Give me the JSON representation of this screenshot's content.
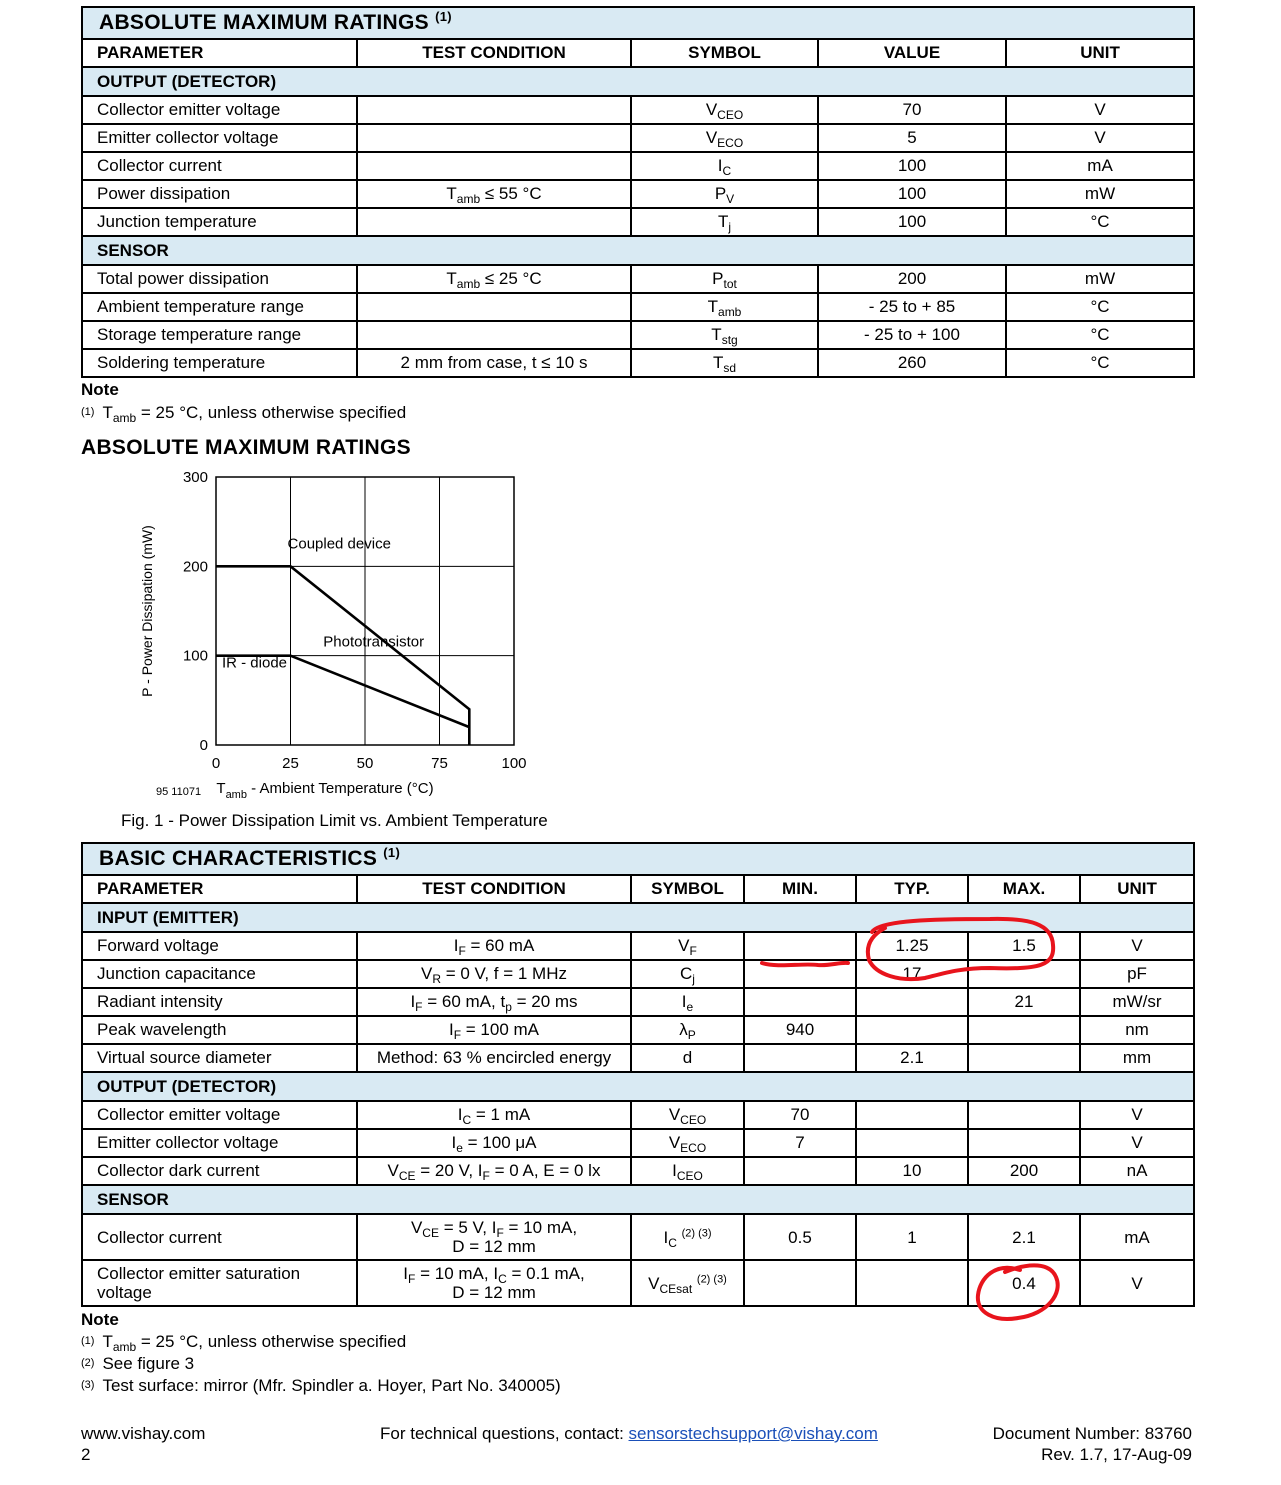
{
  "abs_table": {
    "title": "ABSOLUTE MAXIMUM RATINGS",
    "title_sup": "(1)",
    "headers": [
      "PARAMETER",
      "TEST CONDITION",
      "SYMBOL",
      "VALUE",
      "UNIT"
    ],
    "sections": [
      {
        "name": "OUTPUT (DETECTOR)",
        "rows": [
          {
            "param": "Collector emitter voltage",
            "cond": "",
            "cond_sub": "",
            "cond_rest": "",
            "sym": "V",
            "sym_sub": "CEO",
            "value": "70",
            "unit": "V"
          },
          {
            "param": "Emitter collector voltage",
            "cond": "",
            "cond_sub": "",
            "cond_rest": "",
            "sym": "V",
            "sym_sub": "ECO",
            "value": "5",
            "unit": "V"
          },
          {
            "param": "Collector current",
            "cond": "",
            "cond_sub": "",
            "cond_rest": "",
            "sym": "I",
            "sym_sub": "C",
            "value": "100",
            "unit": "mA"
          },
          {
            "param": "Power dissipation",
            "cond": "T",
            "cond_sub": "amb",
            "cond_rest": " ≤ 55 °C",
            "sym": "P",
            "sym_sub": "V",
            "value": "100",
            "unit": "mW"
          },
          {
            "param": "Junction temperature",
            "cond": "",
            "cond_sub": "",
            "cond_rest": "",
            "sym": "T",
            "sym_sub": "j",
            "value": "100",
            "unit": "°C"
          }
        ]
      },
      {
        "name": "SENSOR",
        "rows": [
          {
            "param": "Total power dissipation",
            "cond": "T",
            "cond_sub": "amb",
            "cond_rest": " ≤ 25 °C",
            "sym": "P",
            "sym_sub": "tot",
            "value": "200",
            "unit": "mW"
          },
          {
            "param": "Ambient temperature range",
            "cond": "",
            "cond_sub": "",
            "cond_rest": "",
            "sym": "T",
            "sym_sub": "amb",
            "value": "- 25 to + 85",
            "unit": "°C"
          },
          {
            "param": "Storage temperature range",
            "cond": "",
            "cond_sub": "",
            "cond_rest": "",
            "sym": "T",
            "sym_sub": "stg",
            "value": "- 25 to + 100",
            "unit": "°C"
          },
          {
            "param": "Soldering temperature",
            "cond": "2 mm from case, t ≤ 10 s",
            "cond_sub": "",
            "cond_rest": "",
            "sym": "T",
            "sym_sub": "sd",
            "value": "260",
            "unit": "°C"
          }
        ]
      }
    ],
    "note_title": "Note",
    "notes": [
      {
        "mark": "(1)",
        "pre": "T",
        "sub": "amb",
        "post": " = 25 °C, unless otherwise specified"
      }
    ]
  },
  "chart_heading": "ABSOLUTE MAXIMUM RATINGS",
  "chart_data": {
    "type": "line",
    "title": "",
    "caption": "Fig. 1 - Power Dissipation Limit vs. Ambient Temperature",
    "figure_id": "95 11071",
    "xlabel_pre": "T",
    "xlabel_sub": "amb",
    "xlabel_post": " - Ambient Temperature (°C)",
    "ylabel": "P - Power Dissipation (mW)",
    "xlim": [
      0,
      100
    ],
    "ylim": [
      0,
      300
    ],
    "xticks": [
      0,
      25,
      50,
      75,
      100
    ],
    "yticks": [
      0,
      100,
      200,
      300
    ],
    "grid": true,
    "series": [
      {
        "name": "Coupled device",
        "x": [
          0,
          25,
          85,
          85
        ],
        "y": [
          200,
          200,
          40,
          0
        ]
      },
      {
        "name": "Phototransistor",
        "x": [
          25,
          85
        ],
        "y": [
          100,
          20
        ]
      },
      {
        "name": "IR - diode",
        "x": [
          0,
          25
        ],
        "y": [
          100,
          100
        ]
      }
    ]
  },
  "basic_table": {
    "title": "BASIC CHARACTERISTICS",
    "title_sup": "(1)",
    "headers": [
      "PARAMETER",
      "TEST CONDITION",
      "SYMBOL",
      "MIN.",
      "TYP.",
      "MAX.",
      "UNIT"
    ],
    "sections": [
      {
        "name": "INPUT (EMITTER)",
        "rows": [
          {
            "param": "Forward voltage",
            "cond": [
              {
                "t": "I"
              },
              {
                "s": "F"
              },
              {
                "t": " = 60 mA"
              }
            ],
            "sym": "V",
            "sym_sub": "F",
            "sym_sup": "",
            "min": "",
            "typ": "1.25",
            "max": "1.5",
            "unit": "V"
          },
          {
            "param": "Junction capacitance",
            "cond": [
              {
                "t": "V"
              },
              {
                "s": "R"
              },
              {
                "t": " = 0 V, f = 1 MHz"
              }
            ],
            "sym": "C",
            "sym_sub": "j",
            "sym_sup": "",
            "min": "",
            "typ": "17",
            "max": "",
            "unit": "pF"
          },
          {
            "param": "Radiant intensity",
            "cond": [
              {
                "t": "I"
              },
              {
                "s": "F"
              },
              {
                "t": " = 60 mA, t"
              },
              {
                "s": "p"
              },
              {
                "t": " = 20 ms"
              }
            ],
            "sym": "I",
            "sym_sub": "e",
            "sym_sup": "",
            "min": "",
            "typ": "",
            "max": "21",
            "unit": "mW/sr"
          },
          {
            "param": "Peak wavelength",
            "cond": [
              {
                "t": "I"
              },
              {
                "s": "F"
              },
              {
                "t": " = 100 mA"
              }
            ],
            "sym": "λ",
            "sym_sub": "P",
            "sym_sup": "",
            "min": "940",
            "typ": "",
            "max": "",
            "unit": "nm"
          },
          {
            "param": "Virtual source diameter",
            "cond": [
              {
                "t": "Method: 63 % encircled energy"
              }
            ],
            "sym": "d",
            "sym_sub": "",
            "sym_sup": "",
            "min": "",
            "typ": "2.1",
            "max": "",
            "unit": "mm"
          }
        ]
      },
      {
        "name": "OUTPUT (DETECTOR)",
        "rows": [
          {
            "param": "Collector emitter voltage",
            "cond": [
              {
                "t": "I"
              },
              {
                "s": "C"
              },
              {
                "t": " = 1 mA"
              }
            ],
            "sym": "V",
            "sym_sub": "CEO",
            "sym_sup": "",
            "min": "70",
            "typ": "",
            "max": "",
            "unit": "V"
          },
          {
            "param": "Emitter collector voltage",
            "cond": [
              {
                "t": "I"
              },
              {
                "s": "e"
              },
              {
                "t": " = 100 μA"
              }
            ],
            "sym": "V",
            "sym_sub": "ECO",
            "sym_sup": "",
            "min": "7",
            "typ": "",
            "max": "",
            "unit": "V"
          },
          {
            "param": "Collector dark current",
            "cond": [
              {
                "t": "V"
              },
              {
                "s": "CE"
              },
              {
                "t": " = 20 V, I"
              },
              {
                "s": "F"
              },
              {
                "t": " = 0 A, E = 0 lx"
              }
            ],
            "sym": "I",
            "sym_sub": "CEO",
            "sym_sup": "",
            "min": "",
            "typ": "10",
            "max": "200",
            "unit": "nA"
          }
        ]
      },
      {
        "name": "SENSOR",
        "rows": [
          {
            "param": "Collector current",
            "param2": "",
            "cond": [
              {
                "t": "V"
              },
              {
                "s": "CE"
              },
              {
                "t": " = 5 V, I"
              },
              {
                "s": "F"
              },
              {
                "t": " = 10 mA,"
              }
            ],
            "cond2": "D = 12 mm",
            "sym": "I",
            "sym_sub": "C",
            "sym_sup": "(2) (3)",
            "min": "0.5",
            "typ": "1",
            "max": "2.1",
            "unit": "mA"
          },
          {
            "param": "Collector emitter saturation",
            "param2": "voltage",
            "cond": [
              {
                "t": "I"
              },
              {
                "s": "F"
              },
              {
                "t": " = 10 mA, I"
              },
              {
                "s": "C"
              },
              {
                "t": " = 0.1 mA,"
              }
            ],
            "cond2": "D = 12 mm",
            "sym": "V",
            "sym_sub": "CEsat",
            "sym_sup": "(2) (3)",
            "min": "",
            "typ": "",
            "max": "0.4",
            "unit": "V"
          }
        ]
      }
    ],
    "note_title": "Note",
    "notes": [
      {
        "mark": "(1)",
        "pre": "T",
        "sub": "amb",
        "post": " = 25 °C, unless otherwise specified"
      },
      {
        "mark": "(2)",
        "pre": "See figure 3",
        "sub": "",
        "post": ""
      },
      {
        "mark": "(3)",
        "pre": "Test surface: mirror (Mfr. Spindler a. Hoyer, Part No. 340005)",
        "sub": "",
        "post": ""
      }
    ]
  },
  "footer": {
    "website": "www.vishay.com",
    "page": "2",
    "contact_text": "For technical questions, contact: ",
    "contact_email": "sensorstechsupport@vishay.com",
    "doc_number": "Document Number: 83760",
    "revision": "Rev. 1.7, 17-Aug-09"
  },
  "annotation_color": "#e8141c"
}
